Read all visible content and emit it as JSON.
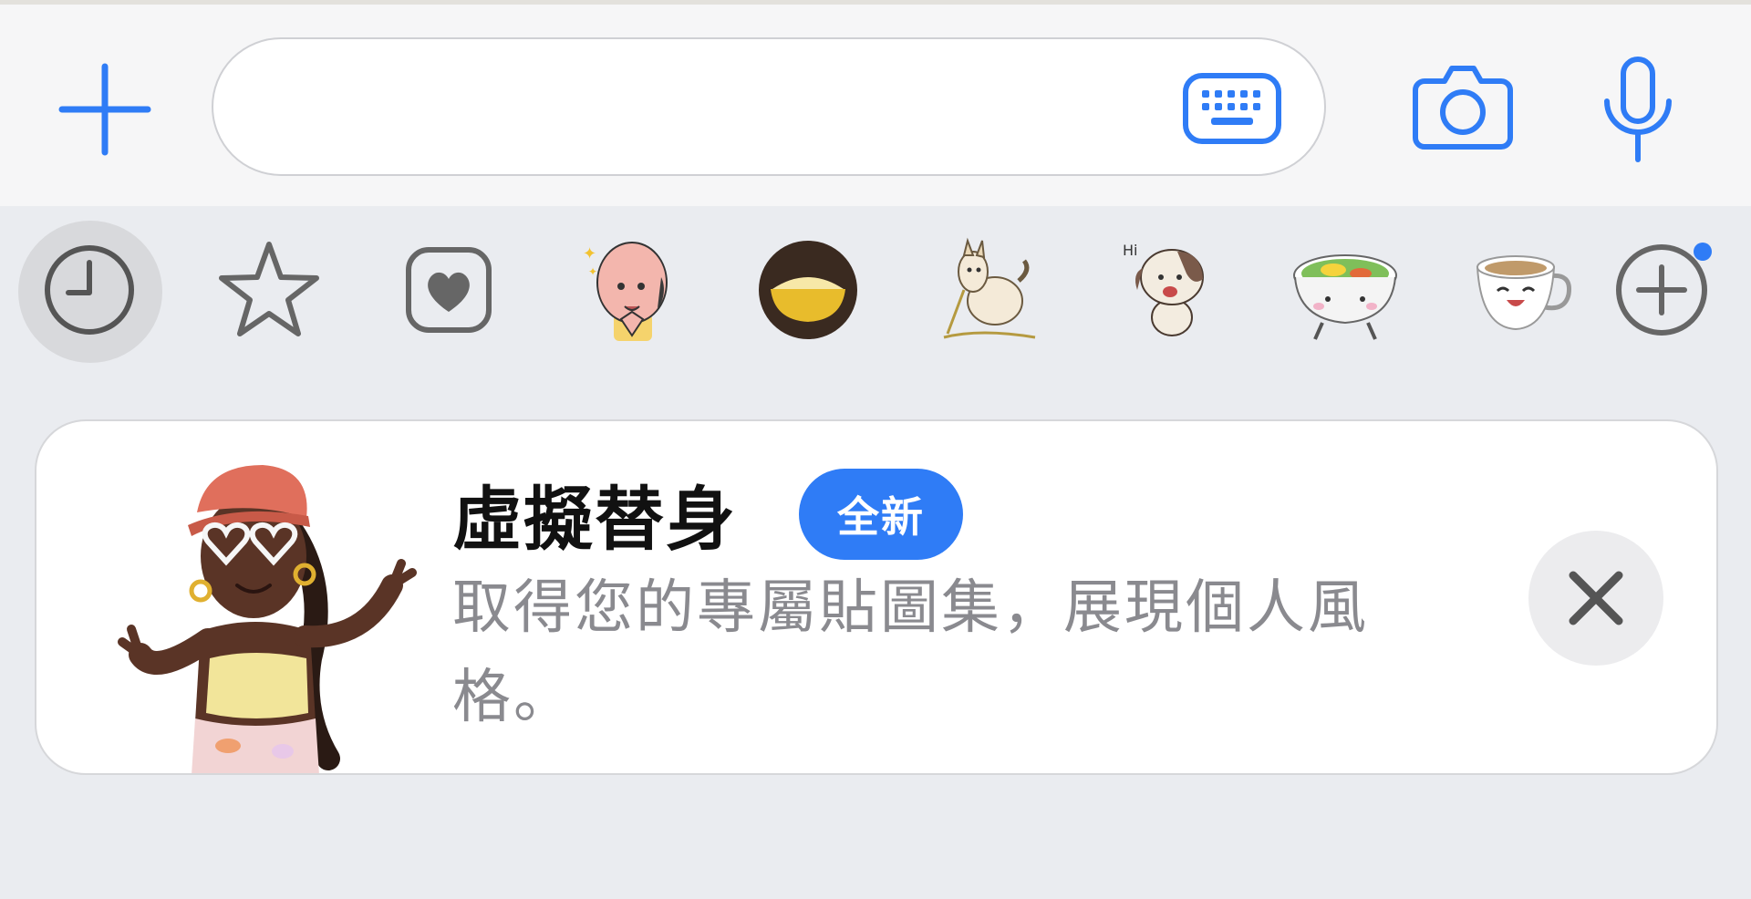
{
  "input_bar": {
    "text_value": "",
    "icons": [
      "plus-icon",
      "keyboard-icon",
      "camera-icon",
      "microphone-icon"
    ]
  },
  "sticker_tray": {
    "items": [
      {
        "name": "recent-icon",
        "selected": true
      },
      {
        "name": "star-icon"
      },
      {
        "name": "heart-icon"
      },
      {
        "name": "sticker-bald-man"
      },
      {
        "name": "sticker-rice-bowl"
      },
      {
        "name": "sticker-dog-leash"
      },
      {
        "name": "sticker-dog-hi",
        "text": "Hi"
      },
      {
        "name": "sticker-bibimbap"
      },
      {
        "name": "sticker-coffee-cup"
      },
      {
        "name": "add-sticker-icon",
        "has_notification_dot": true
      }
    ]
  },
  "banner": {
    "title": "虛擬替身",
    "badge": "全新",
    "description": "取得您的專屬貼圖集，展現個人風格。"
  },
  "colors": {
    "accent": "#2f7cf6",
    "tray_background": "#eaecf0",
    "input_background": "#f6f6f7",
    "banner_text_secondary": "#8a8a8f"
  }
}
